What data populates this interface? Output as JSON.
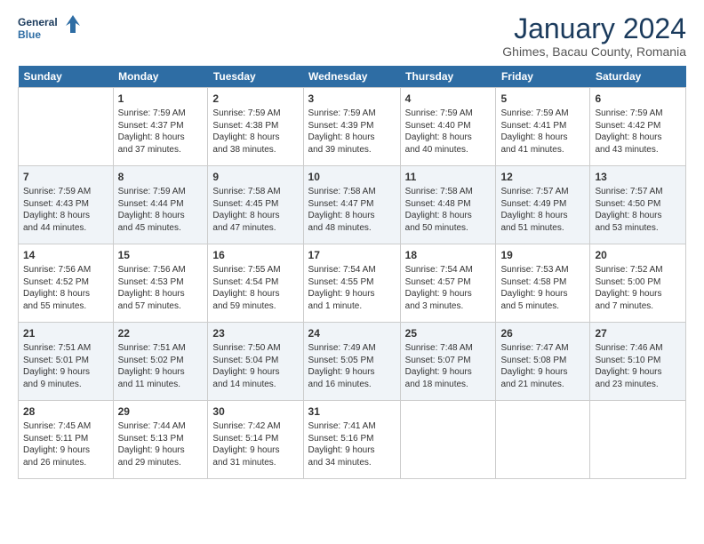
{
  "logo": {
    "line1": "General",
    "line2": "Blue"
  },
  "title": "January 2024",
  "subtitle": "Ghimes, Bacau County, Romania",
  "weekdays": [
    "Sunday",
    "Monday",
    "Tuesday",
    "Wednesday",
    "Thursday",
    "Friday",
    "Saturday"
  ],
  "weeks": [
    [
      {
        "day": "",
        "info": ""
      },
      {
        "day": "1",
        "info": "Sunrise: 7:59 AM\nSunset: 4:37 PM\nDaylight: 8 hours\nand 37 minutes."
      },
      {
        "day": "2",
        "info": "Sunrise: 7:59 AM\nSunset: 4:38 PM\nDaylight: 8 hours\nand 38 minutes."
      },
      {
        "day": "3",
        "info": "Sunrise: 7:59 AM\nSunset: 4:39 PM\nDaylight: 8 hours\nand 39 minutes."
      },
      {
        "day": "4",
        "info": "Sunrise: 7:59 AM\nSunset: 4:40 PM\nDaylight: 8 hours\nand 40 minutes."
      },
      {
        "day": "5",
        "info": "Sunrise: 7:59 AM\nSunset: 4:41 PM\nDaylight: 8 hours\nand 41 minutes."
      },
      {
        "day": "6",
        "info": "Sunrise: 7:59 AM\nSunset: 4:42 PM\nDaylight: 8 hours\nand 43 minutes."
      }
    ],
    [
      {
        "day": "7",
        "info": "Sunrise: 7:59 AM\nSunset: 4:43 PM\nDaylight: 8 hours\nand 44 minutes."
      },
      {
        "day": "8",
        "info": "Sunrise: 7:59 AM\nSunset: 4:44 PM\nDaylight: 8 hours\nand 45 minutes."
      },
      {
        "day": "9",
        "info": "Sunrise: 7:58 AM\nSunset: 4:45 PM\nDaylight: 8 hours\nand 47 minutes."
      },
      {
        "day": "10",
        "info": "Sunrise: 7:58 AM\nSunset: 4:47 PM\nDaylight: 8 hours\nand 48 minutes."
      },
      {
        "day": "11",
        "info": "Sunrise: 7:58 AM\nSunset: 4:48 PM\nDaylight: 8 hours\nand 50 minutes."
      },
      {
        "day": "12",
        "info": "Sunrise: 7:57 AM\nSunset: 4:49 PM\nDaylight: 8 hours\nand 51 minutes."
      },
      {
        "day": "13",
        "info": "Sunrise: 7:57 AM\nSunset: 4:50 PM\nDaylight: 8 hours\nand 53 minutes."
      }
    ],
    [
      {
        "day": "14",
        "info": "Sunrise: 7:56 AM\nSunset: 4:52 PM\nDaylight: 8 hours\nand 55 minutes."
      },
      {
        "day": "15",
        "info": "Sunrise: 7:56 AM\nSunset: 4:53 PM\nDaylight: 8 hours\nand 57 minutes."
      },
      {
        "day": "16",
        "info": "Sunrise: 7:55 AM\nSunset: 4:54 PM\nDaylight: 8 hours\nand 59 minutes."
      },
      {
        "day": "17",
        "info": "Sunrise: 7:54 AM\nSunset: 4:55 PM\nDaylight: 9 hours\nand 1 minute."
      },
      {
        "day": "18",
        "info": "Sunrise: 7:54 AM\nSunset: 4:57 PM\nDaylight: 9 hours\nand 3 minutes."
      },
      {
        "day": "19",
        "info": "Sunrise: 7:53 AM\nSunset: 4:58 PM\nDaylight: 9 hours\nand 5 minutes."
      },
      {
        "day": "20",
        "info": "Sunrise: 7:52 AM\nSunset: 5:00 PM\nDaylight: 9 hours\nand 7 minutes."
      }
    ],
    [
      {
        "day": "21",
        "info": "Sunrise: 7:51 AM\nSunset: 5:01 PM\nDaylight: 9 hours\nand 9 minutes."
      },
      {
        "day": "22",
        "info": "Sunrise: 7:51 AM\nSunset: 5:02 PM\nDaylight: 9 hours\nand 11 minutes."
      },
      {
        "day": "23",
        "info": "Sunrise: 7:50 AM\nSunset: 5:04 PM\nDaylight: 9 hours\nand 14 minutes."
      },
      {
        "day": "24",
        "info": "Sunrise: 7:49 AM\nSunset: 5:05 PM\nDaylight: 9 hours\nand 16 minutes."
      },
      {
        "day": "25",
        "info": "Sunrise: 7:48 AM\nSunset: 5:07 PM\nDaylight: 9 hours\nand 18 minutes."
      },
      {
        "day": "26",
        "info": "Sunrise: 7:47 AM\nSunset: 5:08 PM\nDaylight: 9 hours\nand 21 minutes."
      },
      {
        "day": "27",
        "info": "Sunrise: 7:46 AM\nSunset: 5:10 PM\nDaylight: 9 hours\nand 23 minutes."
      }
    ],
    [
      {
        "day": "28",
        "info": "Sunrise: 7:45 AM\nSunset: 5:11 PM\nDaylight: 9 hours\nand 26 minutes."
      },
      {
        "day": "29",
        "info": "Sunrise: 7:44 AM\nSunset: 5:13 PM\nDaylight: 9 hours\nand 29 minutes."
      },
      {
        "day": "30",
        "info": "Sunrise: 7:42 AM\nSunset: 5:14 PM\nDaylight: 9 hours\nand 31 minutes."
      },
      {
        "day": "31",
        "info": "Sunrise: 7:41 AM\nSunset: 5:16 PM\nDaylight: 9 hours\nand 34 minutes."
      },
      {
        "day": "",
        "info": ""
      },
      {
        "day": "",
        "info": ""
      },
      {
        "day": "",
        "info": ""
      }
    ]
  ]
}
